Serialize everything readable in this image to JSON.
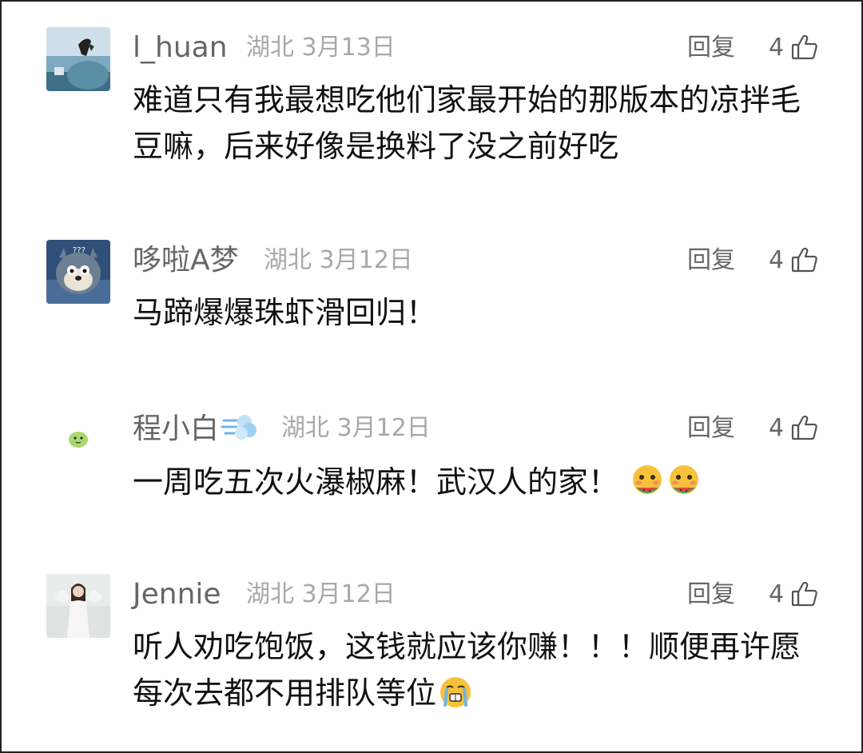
{
  "comments": [
    {
      "username": "l_huan",
      "location": "湖北",
      "date": "3月13日",
      "reply_label": "回复",
      "likes": "4",
      "text": "难道只有我最想吃他们家最开始的那版本的凉拌毛豆嘛，后来好像是换料了没之前好吃"
    },
    {
      "username": "哆啦A梦",
      "location": "湖北",
      "date": "3月12日",
      "reply_label": "回复",
      "likes": "4",
      "text": "马蹄爆爆珠虾滑回归！"
    },
    {
      "username": "程小白",
      "location": "湖北",
      "date": "3月12日",
      "reply_label": "回复",
      "likes": "4",
      "text": "一周吃五次火瀑椒麻！武汉人的家！"
    },
    {
      "username": "Jennie",
      "location": "湖北",
      "date": "3月12日",
      "reply_label": "回复",
      "likes": "4",
      "text": "听人劝吃饱饭，这钱就应该你赚！！！顺便再许愿每次去都不用排队等位"
    }
  ],
  "icons": {
    "like": "thumbs-up-icon",
    "dash": "dash-emoji",
    "eating": "eating-watermelon-emoji",
    "crying": "crying-emoji"
  }
}
